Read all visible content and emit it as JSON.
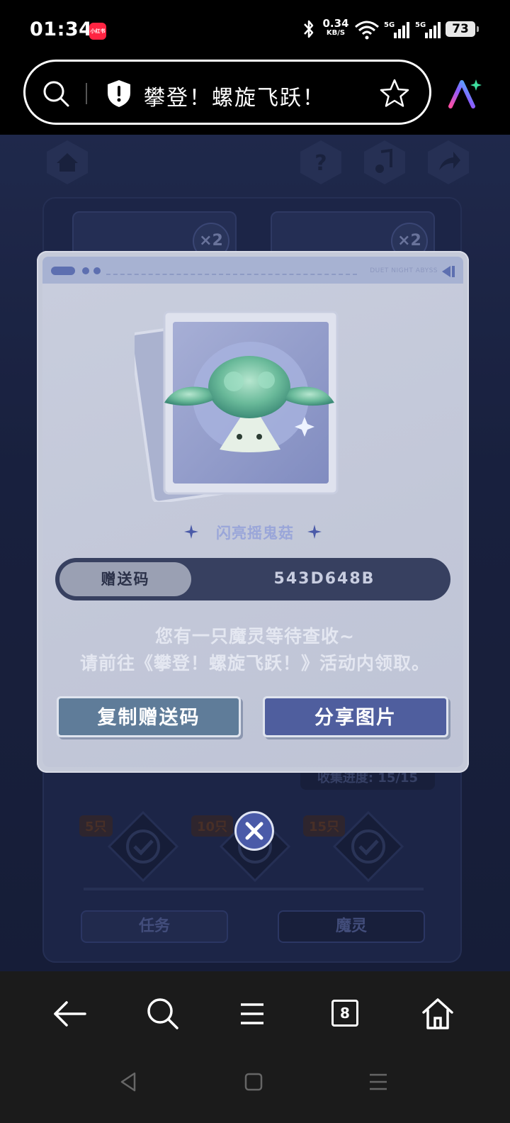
{
  "status_bar": {
    "time": "01:34",
    "app_badge": "小红书",
    "net_speed_value": "0.34",
    "net_speed_unit": "KB/S",
    "sim1_label": "5G",
    "sim2_label": "5G",
    "battery": "73"
  },
  "browser": {
    "page_title": "攀登！螺旋飞跃！"
  },
  "game": {
    "card_multiplier_1": "×2",
    "card_multiplier_2": "×2",
    "collection_progress": "收集进度: 15/15",
    "milestones": [
      "5只",
      "10只",
      "15只"
    ],
    "tab_task": "任务",
    "tab_spirit": "魔灵"
  },
  "modal": {
    "brand_text": "DUET NIGHT ABYSS",
    "creature_name": "闪亮摇鬼菇",
    "code_label": "赠送码",
    "code_value": "543D648B",
    "message_line1": "您有一只魔灵等待查收~",
    "message_line2": "请前往《攀登！螺旋飞跃！》活动内领取。",
    "copy_button": "复制赠送码",
    "share_button": "分享图片"
  },
  "bottom_nav": {
    "tab_count": "8"
  },
  "colors": {
    "modal_bg": "#c5cad9",
    "code_bar": "#374060",
    "copy_button": "#5f7c99",
    "share_button": "#4f5e9e",
    "close_button": "#4a5aa8",
    "creature_name": "#9aa6d9"
  }
}
